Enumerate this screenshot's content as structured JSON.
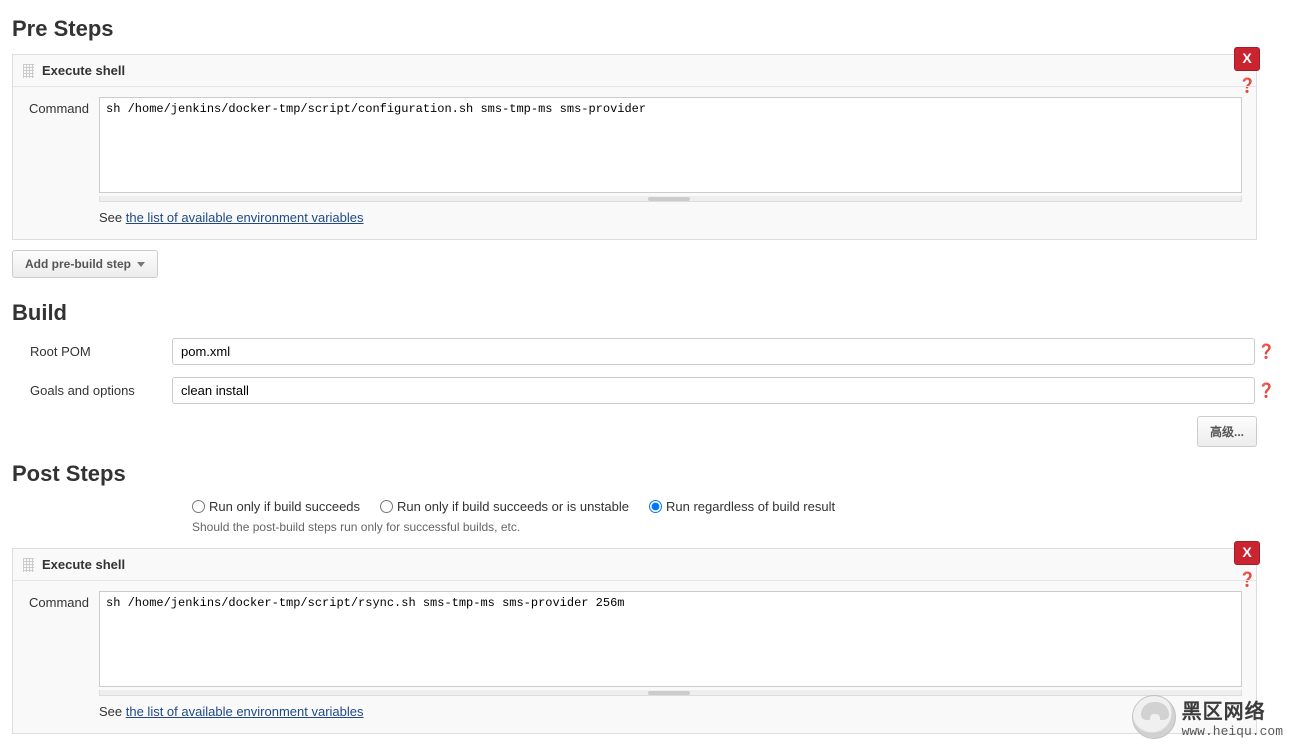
{
  "preSteps": {
    "heading": "Pre Steps",
    "shell": {
      "title": "Execute shell",
      "commandLabel": "Command",
      "command": "sh /home/jenkins/docker-tmp/script/configuration.sh sms-tmp-ms sms-provider",
      "deleteLabel": "X",
      "seePrefix": "See ",
      "envLink": "the list of available environment variables"
    },
    "addButton": "Add pre-build step"
  },
  "build": {
    "heading": "Build",
    "rootPomLabel": "Root POM",
    "rootPom": "pom.xml",
    "goalsLabel": "Goals and options",
    "goals": "clean install",
    "advanced": "高级..."
  },
  "postSteps": {
    "heading": "Post Steps",
    "options": {
      "succeeds": "Run only if build succeeds",
      "unstable": "Run only if build succeeds or is unstable",
      "regardless": "Run regardless of build result",
      "selected": "regardless"
    },
    "hint": "Should the post-build steps run only for successful builds, etc.",
    "shell": {
      "title": "Execute shell",
      "commandLabel": "Command",
      "command": "sh /home/jenkins/docker-tmp/script/rsync.sh sms-tmp-ms sms-provider 256m",
      "deleteLabel": "X",
      "seePrefix": "See ",
      "envLink": "the list of available environment variables"
    }
  },
  "watermark": {
    "cn": "黑区网络",
    "url": "www.heiqu.com"
  }
}
